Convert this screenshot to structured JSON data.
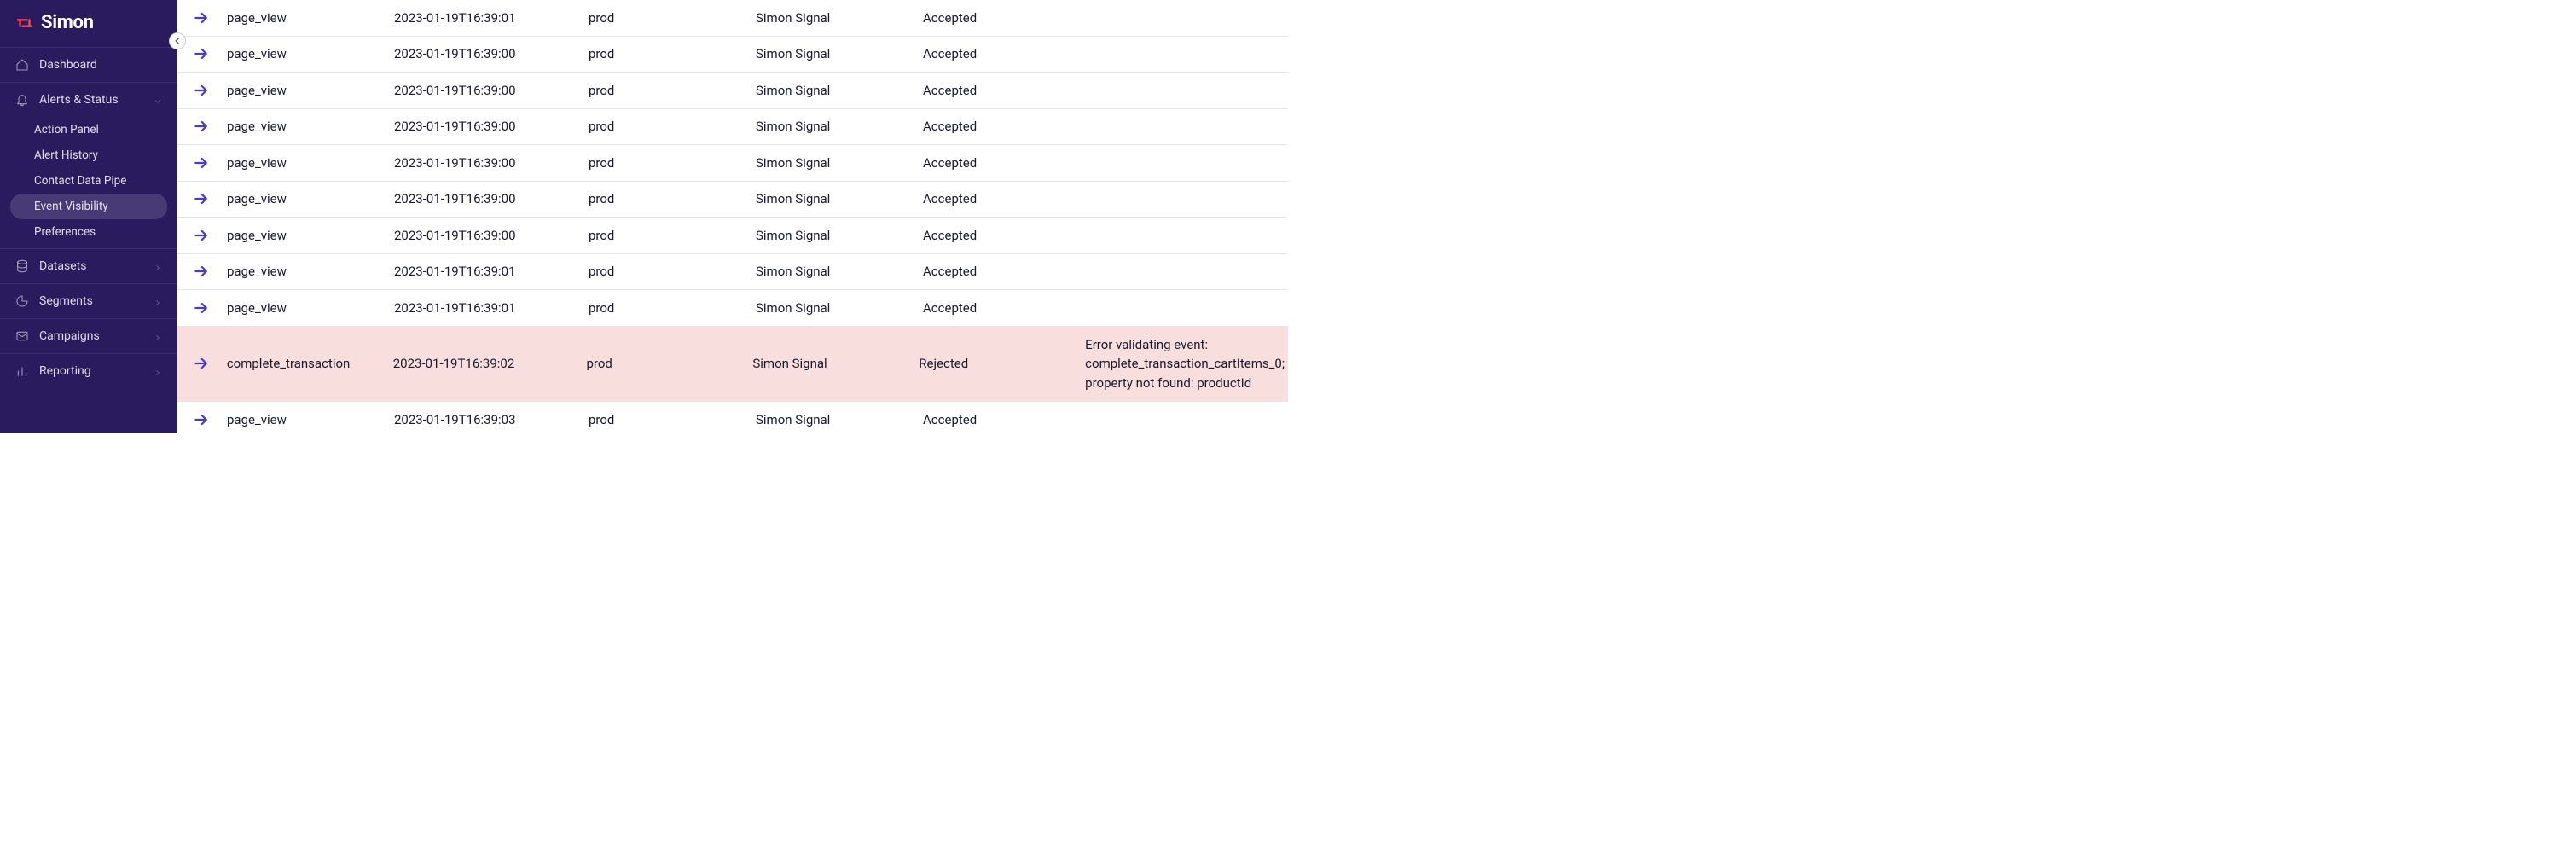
{
  "brand": {
    "name": "Simon"
  },
  "sidebar": {
    "items": [
      {
        "label": "Dashboard",
        "icon": "home"
      },
      {
        "label": "Alerts & Status",
        "icon": "bell",
        "expanded": true,
        "children": [
          {
            "label": "Action Panel"
          },
          {
            "label": "Alert History"
          },
          {
            "label": "Contact Data Pipe"
          },
          {
            "label": "Event Visibility",
            "active": true
          },
          {
            "label": "Preferences"
          }
        ]
      },
      {
        "label": "Datasets",
        "icon": "database"
      },
      {
        "label": "Segments",
        "icon": "pie"
      },
      {
        "label": "Campaigns",
        "icon": "envelope"
      },
      {
        "label": "Reporting",
        "icon": "bars"
      }
    ]
  },
  "events": [
    {
      "name": "page_view",
      "ts": "2023-01-19T16:39:01",
      "env": "prod",
      "source": "Simon Signal",
      "status": "Accepted",
      "error": ""
    },
    {
      "name": "page_view",
      "ts": "2023-01-19T16:39:00",
      "env": "prod",
      "source": "Simon Signal",
      "status": "Accepted",
      "error": ""
    },
    {
      "name": "page_view",
      "ts": "2023-01-19T16:39:00",
      "env": "prod",
      "source": "Simon Signal",
      "status": "Accepted",
      "error": ""
    },
    {
      "name": "page_view",
      "ts": "2023-01-19T16:39:00",
      "env": "prod",
      "source": "Simon Signal",
      "status": "Accepted",
      "error": ""
    },
    {
      "name": "page_view",
      "ts": "2023-01-19T16:39:00",
      "env": "prod",
      "source": "Simon Signal",
      "status": "Accepted",
      "error": ""
    },
    {
      "name": "page_view",
      "ts": "2023-01-19T16:39:00",
      "env": "prod",
      "source": "Simon Signal",
      "status": "Accepted",
      "error": ""
    },
    {
      "name": "page_view",
      "ts": "2023-01-19T16:39:00",
      "env": "prod",
      "source": "Simon Signal",
      "status": "Accepted",
      "error": ""
    },
    {
      "name": "page_view",
      "ts": "2023-01-19T16:39:01",
      "env": "prod",
      "source": "Simon Signal",
      "status": "Accepted",
      "error": ""
    },
    {
      "name": "page_view",
      "ts": "2023-01-19T16:39:01",
      "env": "prod",
      "source": "Simon Signal",
      "status": "Accepted",
      "error": ""
    },
    {
      "name": "complete_transaction",
      "ts": "2023-01-19T16:39:02",
      "env": "prod",
      "source": "Simon Signal",
      "status": "Rejected",
      "error": "Error validating event: complete_transaction_cartItems_0; property not found: productId"
    },
    {
      "name": "page_view",
      "ts": "2023-01-19T16:39:03",
      "env": "prod",
      "source": "Simon Signal",
      "status": "Accepted",
      "error": ""
    }
  ]
}
